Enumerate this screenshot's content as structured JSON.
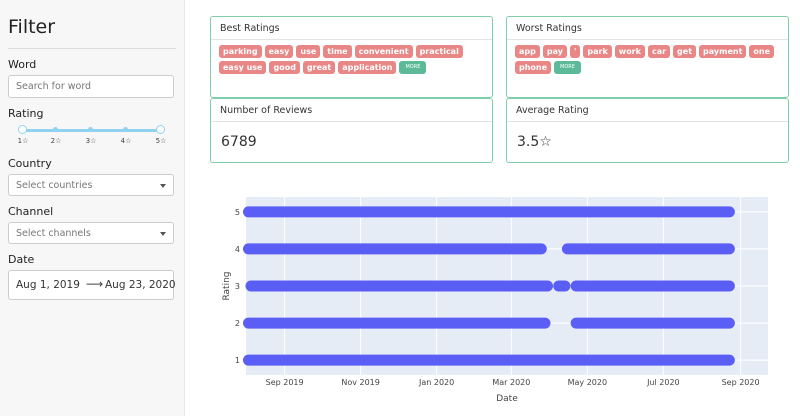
{
  "sidebar": {
    "title": "Filter",
    "word_label": "Word",
    "word_placeholder": "Search for word",
    "rating_label": "Rating",
    "rating_ticks": [
      "1☆",
      "2☆",
      "3☆",
      "4☆",
      "5☆"
    ],
    "country_label": "Country",
    "country_placeholder": "Select countries",
    "channel_label": "Channel",
    "channel_placeholder": "Select channels",
    "date_label": "Date",
    "date_start": "Aug 1, 2019",
    "date_end": "Aug 23, 2020"
  },
  "best": {
    "title": "Best Ratings",
    "tags": [
      "parking",
      "easy",
      "use",
      "time",
      "convenient",
      "practical",
      "easy use",
      "good",
      "great",
      "application"
    ],
    "more": "MORE"
  },
  "worst": {
    "title": "Worst Ratings",
    "tags": [
      "app",
      "pay",
      "'",
      "park",
      "work",
      "car",
      "get",
      "payment",
      "one",
      "phone"
    ],
    "more": "MORE"
  },
  "reviews": {
    "title": "Number of Reviews",
    "value": "6789"
  },
  "average": {
    "title": "Average Rating",
    "value": "3.5☆"
  },
  "colors": {
    "accent": "#7fcfab",
    "tag_red": "#e98787",
    "tag_green": "#5cba99",
    "points": "#5b5ef5",
    "plot_bg": "#e5ecf6"
  },
  "chart_data": {
    "type": "scatter",
    "xlabel": "Date",
    "ylabel": "Rating",
    "x_ticks": [
      "Sep 2019",
      "Nov 2019",
      "Jan 2020",
      "Mar 2020",
      "May 2020",
      "Jul 2020",
      "Sep 2020"
    ],
    "y_ticks": [
      "1",
      "2",
      "3",
      "4",
      "5"
    ],
    "xlim": [
      "2019-08-01",
      "2020-09-23"
    ],
    "ylim": [
      0.6,
      5.4
    ],
    "series": [
      {
        "rating": 5,
        "segments": [
          [
            "2019-08-03",
            "2020-08-23"
          ]
        ]
      },
      {
        "rating": 4,
        "segments": [
          [
            "2019-08-03",
            "2020-03-25"
          ],
          [
            "2020-04-15",
            "2020-08-23"
          ]
        ]
      },
      {
        "rating": 3,
        "segments": [
          [
            "2019-08-05",
            "2020-03-30"
          ],
          [
            "2020-04-08",
            "2020-04-13"
          ],
          [
            "2020-04-22",
            "2020-08-23"
          ]
        ]
      },
      {
        "rating": 2,
        "segments": [
          [
            "2019-08-03",
            "2020-03-28"
          ],
          [
            "2020-04-22",
            "2020-08-23"
          ]
        ]
      },
      {
        "rating": 1,
        "segments": [
          [
            "2019-08-03",
            "2020-08-23"
          ]
        ]
      }
    ]
  }
}
